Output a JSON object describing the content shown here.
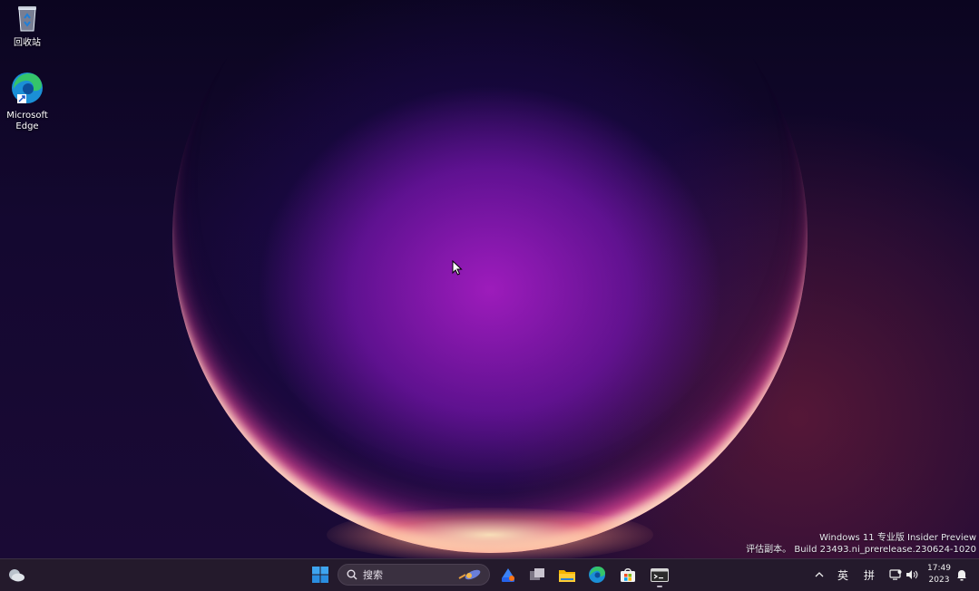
{
  "desktop": {
    "icons": [
      {
        "label": "回收站",
        "icon": "recycle-bin-icon"
      },
      {
        "label": "Microsoft\nEdge",
        "icon": "edge-icon"
      }
    ],
    "watermark": {
      "line1": "Windows 11 专业版 Insider Preview",
      "line2": "评估副本。 Build 23493.ni_prerelease.230624-1020"
    }
  },
  "taskbar": {
    "search_label": "搜索",
    "apps": [
      "start-icon",
      "copilot-icon",
      "task-view-icon",
      "file-explorer-icon",
      "edge-icon",
      "store-icon",
      "terminal-icon"
    ],
    "tray": {
      "input_lang": "英",
      "ime_mode": "拼",
      "time": "17:49",
      "date": "2023"
    }
  },
  "colors": {
    "taskbar": "#241a2c",
    "accent": "#0078d4"
  }
}
